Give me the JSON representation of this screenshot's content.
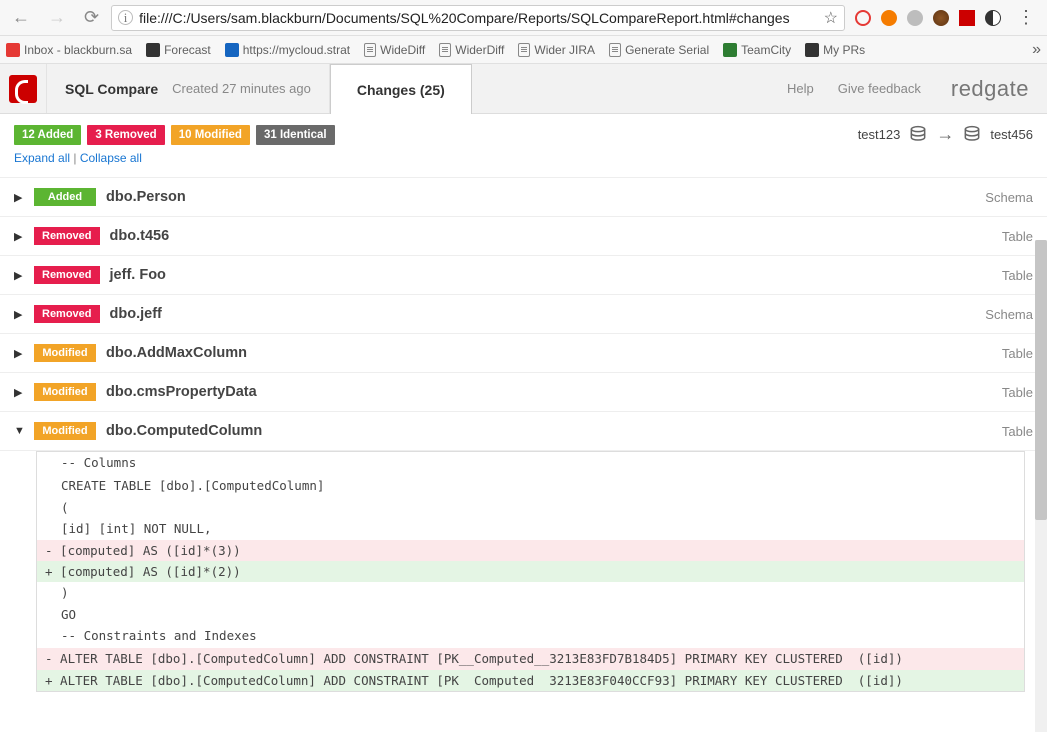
{
  "chrome": {
    "url": "file:///C:/Users/sam.blackburn/Documents/SQL%20Compare/Reports/SQLCompareReport.html#changes"
  },
  "bookmarks": [
    {
      "label": "Inbox - blackburn.sa",
      "color": "#e53935"
    },
    {
      "label": "Forecast",
      "color": "#333"
    },
    {
      "label": "https://mycloud.strat",
      "color": "#1565c0"
    },
    {
      "label": "WideDiff",
      "doc": true
    },
    {
      "label": "WiderDiff",
      "doc": true
    },
    {
      "label": "Wider JIRA",
      "doc": true
    },
    {
      "label": "Generate Serial",
      "doc": true
    },
    {
      "label": "TeamCity",
      "color": "#2e7d32"
    },
    {
      "label": "My PRs",
      "color": "#333"
    }
  ],
  "header": {
    "app_name": "SQL Compare",
    "created": "Created 27 minutes ago",
    "tab_label": "Changes (25)",
    "help": "Help",
    "feedback": "Give feedback",
    "brand": "redgate"
  },
  "summary": {
    "added": "12 Added",
    "removed": "3 Removed",
    "modified": "10 Modified",
    "identical": "31 Identical",
    "source_db": "test123",
    "target_db": "test456"
  },
  "controls": {
    "expand_all": "Expand all",
    "collapse_all": "Collapse all"
  },
  "items": [
    {
      "status": "added",
      "status_label": "Added",
      "name": "dbo.Person",
      "type": "Schema",
      "expanded": false
    },
    {
      "status": "removed",
      "status_label": "Removed",
      "name": "dbo.t456",
      "type": "Table",
      "expanded": false
    },
    {
      "status": "removed",
      "status_label": "Removed",
      "name": "jeff. Foo",
      "type": "Table",
      "expanded": false
    },
    {
      "status": "removed",
      "status_label": "Removed",
      "name": "dbo.jeff",
      "type": "Schema",
      "expanded": false
    },
    {
      "status": "modified",
      "status_label": "Modified",
      "name": "dbo.AddMaxColumn",
      "type": "Table",
      "expanded": false
    },
    {
      "status": "modified",
      "status_label": "Modified",
      "name": "dbo.cmsPropertyData",
      "type": "Table",
      "expanded": false
    },
    {
      "status": "modified",
      "status_label": "Modified",
      "name": "dbo.ComputedColumn",
      "type": "Table",
      "expanded": true
    }
  ],
  "diff": [
    {
      "kind": "plain",
      "text": "-- Columns"
    },
    {
      "kind": "plain",
      "text": ""
    },
    {
      "kind": "plain",
      "text": "CREATE TABLE [dbo].[ComputedColumn]"
    },
    {
      "kind": "plain",
      "text": "("
    },
    {
      "kind": "plain",
      "text": "[id] [int] NOT NULL,"
    },
    {
      "kind": "minus",
      "text": "- [computed] AS ([id]*(3))"
    },
    {
      "kind": "plus",
      "text": "+ [computed] AS ([id]*(2))"
    },
    {
      "kind": "plain",
      "text": ")"
    },
    {
      "kind": "plain",
      "text": "GO"
    },
    {
      "kind": "plain",
      "text": "-- Constraints and Indexes"
    },
    {
      "kind": "plain",
      "text": ""
    },
    {
      "kind": "minus",
      "text": "- ALTER TABLE [dbo].[ComputedColumn] ADD CONSTRAINT [PK__Computed__3213E83FD7B184D5] PRIMARY KEY CLUSTERED  ([id])"
    },
    {
      "kind": "plus",
      "text": "+ ALTER TABLE [dbo].[ComputedColumn] ADD CONSTRAINT [PK  Computed  3213E83F040CCF93] PRIMARY KEY CLUSTERED  ([id])"
    }
  ]
}
